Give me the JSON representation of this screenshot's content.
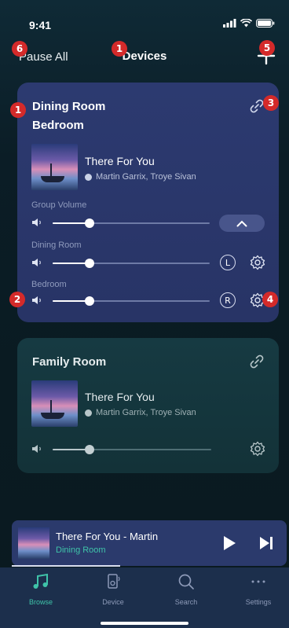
{
  "status_bar": {
    "time": "9:41"
  },
  "header": {
    "left_action": "Pause All",
    "title": "Devices"
  },
  "badges": [
    "1",
    "1",
    "2",
    "3",
    "4",
    "5",
    "6"
  ],
  "group_card": {
    "rooms": [
      "Dining Room",
      "Bedroom"
    ],
    "track": {
      "title": "There For You",
      "artist": "Martin Garrix, Troye Sivan"
    },
    "volumes": [
      {
        "label": "Group Volume",
        "level": 0.3
      },
      {
        "label": "Dining Room",
        "level": 0.3,
        "channel": "L"
      },
      {
        "label": "Bedroom",
        "level": 0.3,
        "channel": "R"
      }
    ]
  },
  "single_card": {
    "room": "Family Room",
    "track": {
      "title": "There For You",
      "artist": "Martin Garrix, Troye Sivan"
    },
    "volume": 0.3
  },
  "now_playing": {
    "title": "There For You - Martin",
    "room": "Dining Room",
    "progress": 0.4
  },
  "tabs": [
    {
      "label": "Browse",
      "icon": "music-note-icon",
      "active": true
    },
    {
      "label": "Device",
      "icon": "device-icon",
      "active": false
    },
    {
      "label": "Search",
      "icon": "search-icon",
      "active": false
    },
    {
      "label": "Settings",
      "icon": "more-icon",
      "active": false
    }
  ],
  "colors": {
    "accent": "#3fc3a9",
    "badge": "#d42a2a",
    "group_card": "#2c3a70",
    "single_card": "#163a42"
  }
}
